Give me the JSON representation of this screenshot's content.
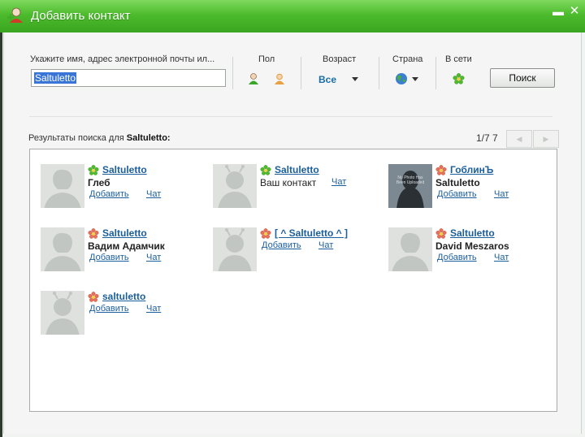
{
  "window": {
    "title": "Добавить контакт",
    "minimize_glyph": "▬",
    "close_glyph": "✕",
    "accent": "#4cbb2c"
  },
  "search": {
    "label": "Укажите имя, адрес электронной почты ил...",
    "value": "Saltuletto",
    "button": "Поиск"
  },
  "filters": {
    "gender_label": "Пол",
    "age_label": "Возраст",
    "age_value": "Все",
    "country_label": "Страна",
    "online_label": "В сети"
  },
  "results": {
    "prefix": "Результаты поиска для ",
    "query": "Saltuletto:",
    "pager": "1/7 7",
    "prev_glyph": "◀",
    "next_glyph": "▶",
    "add_label": "Добавить",
    "chat_label": "Чат",
    "items": [
      {
        "name": "Saltuletto",
        "subtitle": "Глеб",
        "status": "online",
        "avatar": "male"
      },
      {
        "name": "Saltuletto",
        "subtitle": "Ваш контакт",
        "status": "online",
        "avatar": "antenna"
      },
      {
        "name": "ГоблинЪ",
        "subtitle": "Saltuletto",
        "status": "offline",
        "avatar": "photo"
      },
      {
        "name": "Saltuletto",
        "subtitle": "Вадим Адамчик",
        "status": "offline",
        "avatar": "male"
      },
      {
        "name": "[ ^ Saltuletto ^ ]",
        "subtitle": "",
        "status": "offline",
        "avatar": "antenna"
      },
      {
        "name": "Saltuletto",
        "subtitle": "David Meszaros",
        "status": "offline",
        "avatar": "male"
      },
      {
        "name": "saltuletto",
        "subtitle": "",
        "status": "offline",
        "avatar": "antenna"
      }
    ],
    "photo_text": "No Photo Has Been Uploaded"
  }
}
